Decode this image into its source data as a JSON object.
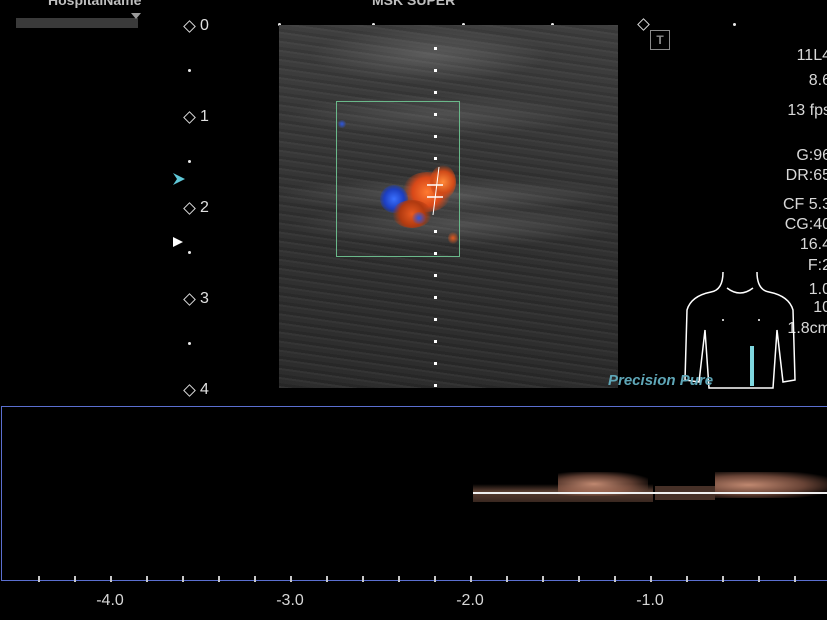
{
  "header": {
    "hospital_name": "HospitalName",
    "study": "MSK SUPER"
  },
  "depth_scale": [
    "0",
    "1",
    "2",
    "3",
    "4"
  ],
  "params": {
    "probe": "11L4",
    "freq": "8.6",
    "fps": "13 fps",
    "gain": "G:96",
    "dynamic_range": "DR:65",
    "color_freq": "CF 5.3",
    "color_gain": "CG:40",
    "prf": "16.4",
    "filter": "F:2",
    "line5": "1.0",
    "line6": "10",
    "depth": "1.8cm"
  },
  "brand": "Precision  Pure",
  "colors": {
    "roi_border": "#6ab88a",
    "doppler_border": "#5b6fd0",
    "flow_red": "#e0501e",
    "flow_blue": "#2a4fd0",
    "spectrum": "#e8a080"
  },
  "icons": {
    "focus_marker": "cyan-arrow-icon",
    "focal_zone": "white-triangle-icon",
    "t_icon": "t-box-icon",
    "body_marker": "body-torso-icon"
  },
  "doppler_axis": [
    "-4.0",
    "-3.0",
    "-2.0",
    "-1.0"
  ]
}
